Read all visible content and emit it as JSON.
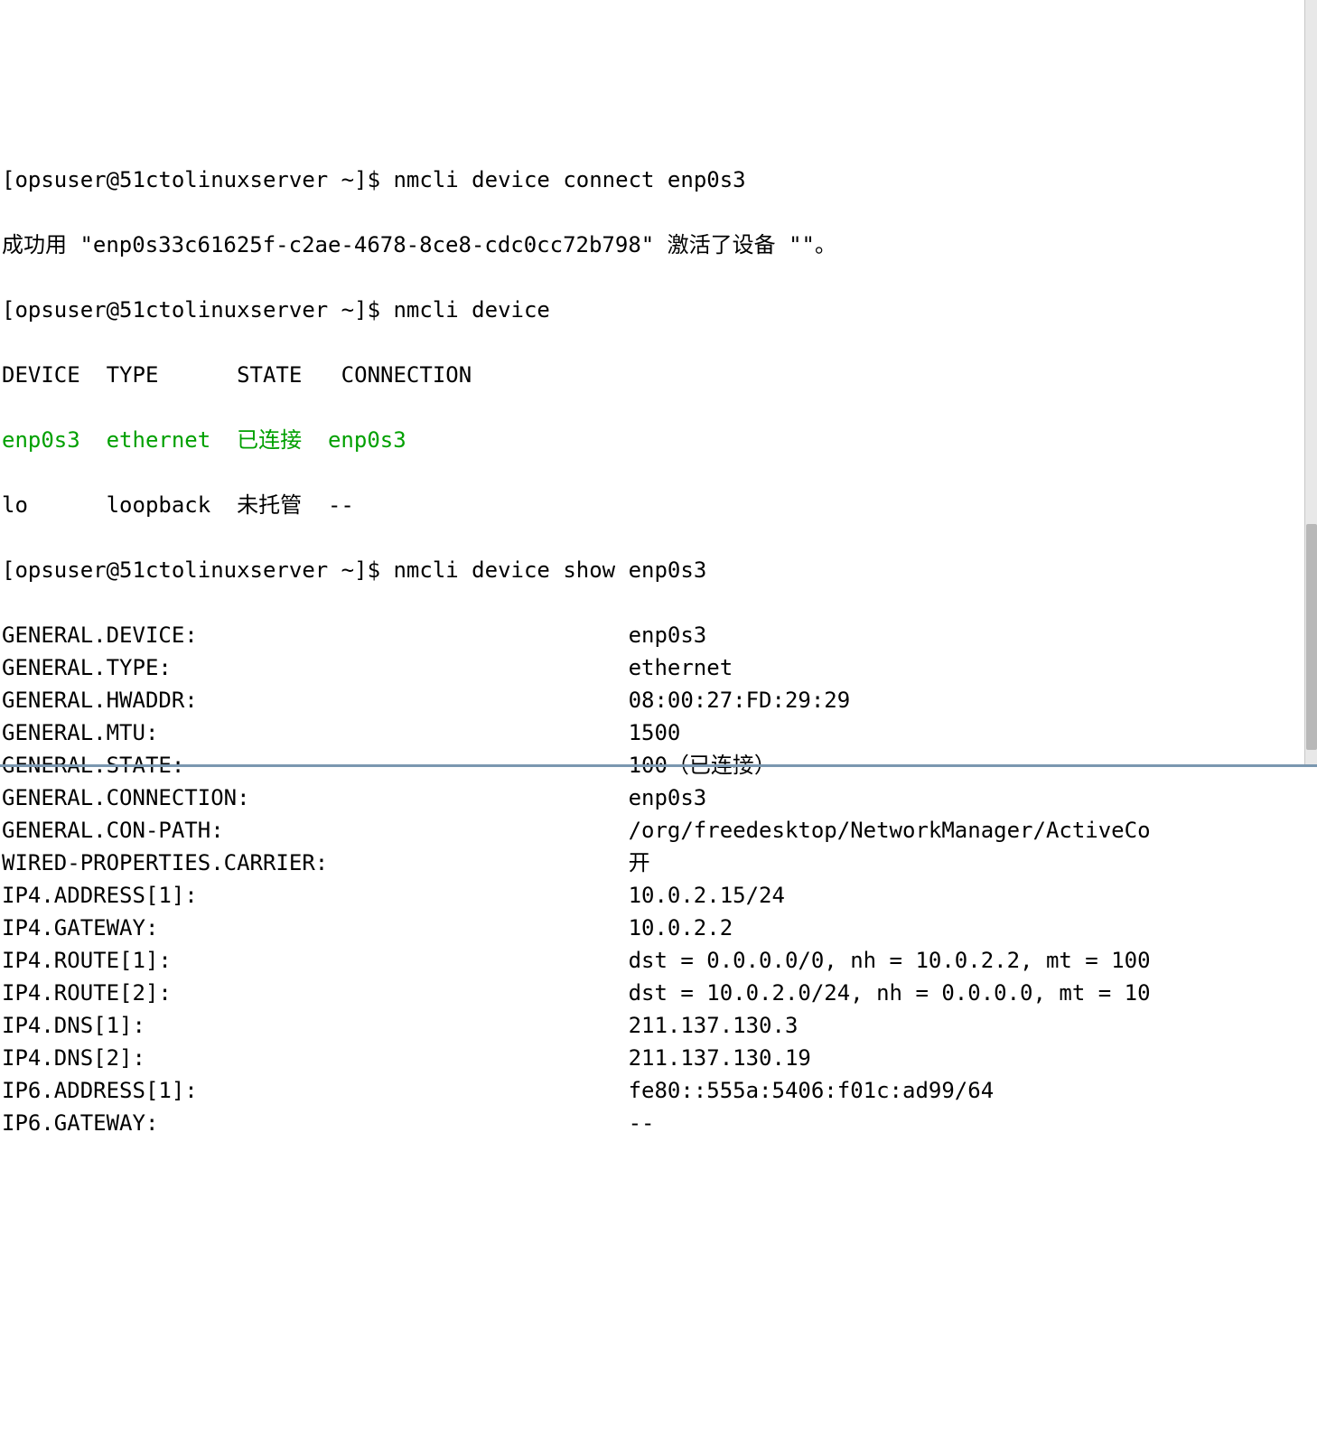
{
  "prompt": "[opsuser@51ctolinuxserver ~]$ ",
  "cmd1": "nmcli device connect enp0s3",
  "line1": "成功用 \"enp0s33c61625f-c2ae-4678-8ce8-cdc0cc72b798\" 激活了设备 \"\"。",
  "cmd2": "nmcli device",
  "tbl_header": "DEVICE  TYPE      STATE   CONNECTION  ",
  "tbl_row1": "enp0s3  ethernet  已连接  enp0s3      ",
  "tbl_row2": "lo      loopback  未托管  --          ",
  "cmd3": "nmcli device show enp0s3",
  "details": [
    {
      "k": "GENERAL.DEVICE:",
      "v": "enp0s3"
    },
    {
      "k": "GENERAL.TYPE:",
      "v": "ethernet"
    },
    {
      "k": "GENERAL.HWADDR:",
      "v": "08:00:27:FD:29:29"
    },
    {
      "k": "GENERAL.MTU:",
      "v": "1500"
    },
    {
      "k": "GENERAL.STATE:",
      "v": "100（已连接）"
    },
    {
      "k": "GENERAL.CONNECTION:",
      "v": "enp0s3"
    },
    {
      "k": "GENERAL.CON-PATH:",
      "v": "/org/freedesktop/NetworkManager/ActiveCo"
    },
    {
      "k": "WIRED-PROPERTIES.CARRIER:",
      "v": "开"
    },
    {
      "k": "IP4.ADDRESS[1]:",
      "v": "10.0.2.15/24"
    },
    {
      "k": "IP4.GATEWAY:",
      "v": "10.0.2.2"
    },
    {
      "k": "IP4.ROUTE[1]:",
      "v": "dst = 0.0.0.0/0, nh = 10.0.2.2, mt = 100"
    },
    {
      "k": "IP4.ROUTE[2]:",
      "v": "dst = 10.0.2.0/24, nh = 0.0.0.0, mt = 10"
    },
    {
      "k": "IP4.DNS[1]:",
      "v": "211.137.130.3"
    },
    {
      "k": "IP4.DNS[2]:",
      "v": "211.137.130.19"
    },
    {
      "k": "IP6.ADDRESS[1]:",
      "v": "fe80::555a:5406:f01c:ad99/64"
    },
    {
      "k": "IP6.GATEWAY:",
      "v": "--"
    }
  ]
}
